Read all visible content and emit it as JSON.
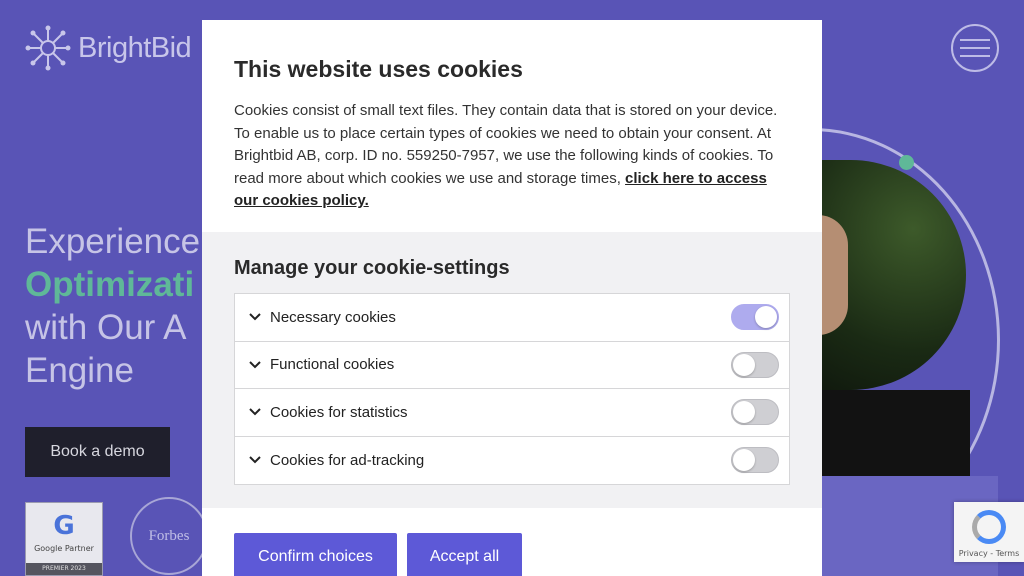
{
  "site": {
    "logo_text": "BrightBid",
    "hero_lines": [
      "Experience",
      "Optimizati",
      "with Our A",
      "Engine"
    ],
    "book_demo": "Book a demo",
    "google_badge": {
      "title": "Google Partner",
      "footer": "PREMIER 2023"
    },
    "forbes_badge": "Forbes",
    "recaptcha": "Privacy - Terms"
  },
  "modal": {
    "title": "This website uses cookies",
    "description": "Cookies consist of small text files. They contain data that is stored on your device. To enable us to place certain types of cookies we need to obtain your consent. At Brightbid AB, corp. ID no. 559250-7957, we use the following kinds of cookies. To read more about which cookies we use and storage times, ",
    "policy_link": "click here to access our cookies policy.",
    "settings_title": "Manage your cookie-settings",
    "categories": [
      {
        "label": "Necessary cookies",
        "enabled": true
      },
      {
        "label": "Functional cookies",
        "enabled": false
      },
      {
        "label": "Cookies for statistics",
        "enabled": false
      },
      {
        "label": "Cookies for ad-tracking",
        "enabled": false
      }
    ],
    "confirm_label": "Confirm choices",
    "accept_label": "Accept all"
  }
}
